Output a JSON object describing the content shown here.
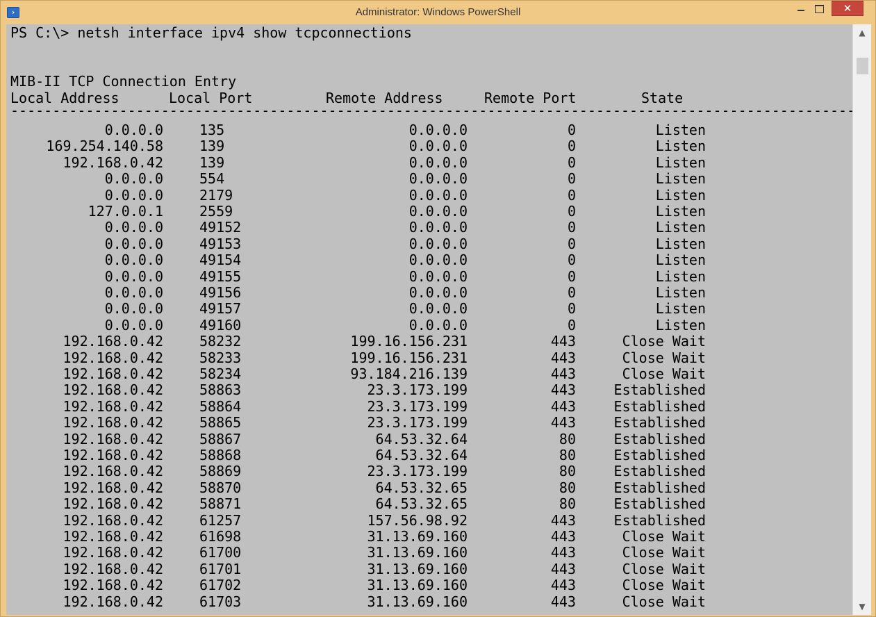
{
  "window": {
    "title": "Administrator: Windows PowerShell",
    "icon": "powershell-icon",
    "controls": {
      "minimize": "minimize-icon",
      "maximize": "maximize-icon",
      "close_label": "✕"
    }
  },
  "console": {
    "command_line": "PS C:\\> netsh interface ipv4 show tcpconnections",
    "section_title": "MIB-II TCP Connection Entry",
    "headers": {
      "local_address": "Local Address",
      "local_port": "Local Port",
      "remote_address": "Remote Address",
      "remote_port": "Remote Port",
      "state": "State"
    },
    "separator": "-----------------------------------------------------------------------------------------------------",
    "rows": [
      {
        "la": "0.0.0.0",
        "lp": "135",
        "ra": "0.0.0.0",
        "rp": "0",
        "st": "Listen"
      },
      {
        "la": "169.254.140.58",
        "lp": "139",
        "ra": "0.0.0.0",
        "rp": "0",
        "st": "Listen"
      },
      {
        "la": "192.168.0.42",
        "lp": "139",
        "ra": "0.0.0.0",
        "rp": "0",
        "st": "Listen"
      },
      {
        "la": "0.0.0.0",
        "lp": "554",
        "ra": "0.0.0.0",
        "rp": "0",
        "st": "Listen"
      },
      {
        "la": "0.0.0.0",
        "lp": "2179",
        "ra": "0.0.0.0",
        "rp": "0",
        "st": "Listen"
      },
      {
        "la": "127.0.0.1",
        "lp": "2559",
        "ra": "0.0.0.0",
        "rp": "0",
        "st": "Listen"
      },
      {
        "la": "0.0.0.0",
        "lp": "49152",
        "ra": "0.0.0.0",
        "rp": "0",
        "st": "Listen"
      },
      {
        "la": "0.0.0.0",
        "lp": "49153",
        "ra": "0.0.0.0",
        "rp": "0",
        "st": "Listen"
      },
      {
        "la": "0.0.0.0",
        "lp": "49154",
        "ra": "0.0.0.0",
        "rp": "0",
        "st": "Listen"
      },
      {
        "la": "0.0.0.0",
        "lp": "49155",
        "ra": "0.0.0.0",
        "rp": "0",
        "st": "Listen"
      },
      {
        "la": "0.0.0.0",
        "lp": "49156",
        "ra": "0.0.0.0",
        "rp": "0",
        "st": "Listen"
      },
      {
        "la": "0.0.0.0",
        "lp": "49157",
        "ra": "0.0.0.0",
        "rp": "0",
        "st": "Listen"
      },
      {
        "la": "0.0.0.0",
        "lp": "49160",
        "ra": "0.0.0.0",
        "rp": "0",
        "st": "Listen"
      },
      {
        "la": "192.168.0.42",
        "lp": "58232",
        "ra": "199.16.156.231",
        "rp": "443",
        "st": "Close Wait"
      },
      {
        "la": "192.168.0.42",
        "lp": "58233",
        "ra": "199.16.156.231",
        "rp": "443",
        "st": "Close Wait"
      },
      {
        "la": "192.168.0.42",
        "lp": "58234",
        "ra": "93.184.216.139",
        "rp": "443",
        "st": "Close Wait"
      },
      {
        "la": "192.168.0.42",
        "lp": "58863",
        "ra": "23.3.173.199",
        "rp": "443",
        "st": "Established"
      },
      {
        "la": "192.168.0.42",
        "lp": "58864",
        "ra": "23.3.173.199",
        "rp": "443",
        "st": "Established"
      },
      {
        "la": "192.168.0.42",
        "lp": "58865",
        "ra": "23.3.173.199",
        "rp": "443",
        "st": "Established"
      },
      {
        "la": "192.168.0.42",
        "lp": "58867",
        "ra": "64.53.32.64",
        "rp": "80",
        "st": "Established"
      },
      {
        "la": "192.168.0.42",
        "lp": "58868",
        "ra": "64.53.32.64",
        "rp": "80",
        "st": "Established"
      },
      {
        "la": "192.168.0.42",
        "lp": "58869",
        "ra": "23.3.173.199",
        "rp": "80",
        "st": "Established"
      },
      {
        "la": "192.168.0.42",
        "lp": "58870",
        "ra": "64.53.32.65",
        "rp": "80",
        "st": "Established"
      },
      {
        "la": "192.168.0.42",
        "lp": "58871",
        "ra": "64.53.32.65",
        "rp": "80",
        "st": "Established"
      },
      {
        "la": "192.168.0.42",
        "lp": "61257",
        "ra": "157.56.98.92",
        "rp": "443",
        "st": "Established"
      },
      {
        "la": "192.168.0.42",
        "lp": "61698",
        "ra": "31.13.69.160",
        "rp": "443",
        "st": "Close Wait"
      },
      {
        "la": "192.168.0.42",
        "lp": "61700",
        "ra": "31.13.69.160",
        "rp": "443",
        "st": "Close Wait"
      },
      {
        "la": "192.168.0.42",
        "lp": "61701",
        "ra": "31.13.69.160",
        "rp": "443",
        "st": "Close Wait"
      },
      {
        "la": "192.168.0.42",
        "lp": "61702",
        "ra": "31.13.69.160",
        "rp": "443",
        "st": "Close Wait"
      },
      {
        "la": "192.168.0.42",
        "lp": "61703",
        "ra": "31.13.69.160",
        "rp": "443",
        "st": "Close Wait"
      }
    ]
  },
  "colors": {
    "titlebar": "#f0c987",
    "console_background": "#c0c0c0",
    "console_text": "#000000",
    "close_button": "#c7463c"
  }
}
